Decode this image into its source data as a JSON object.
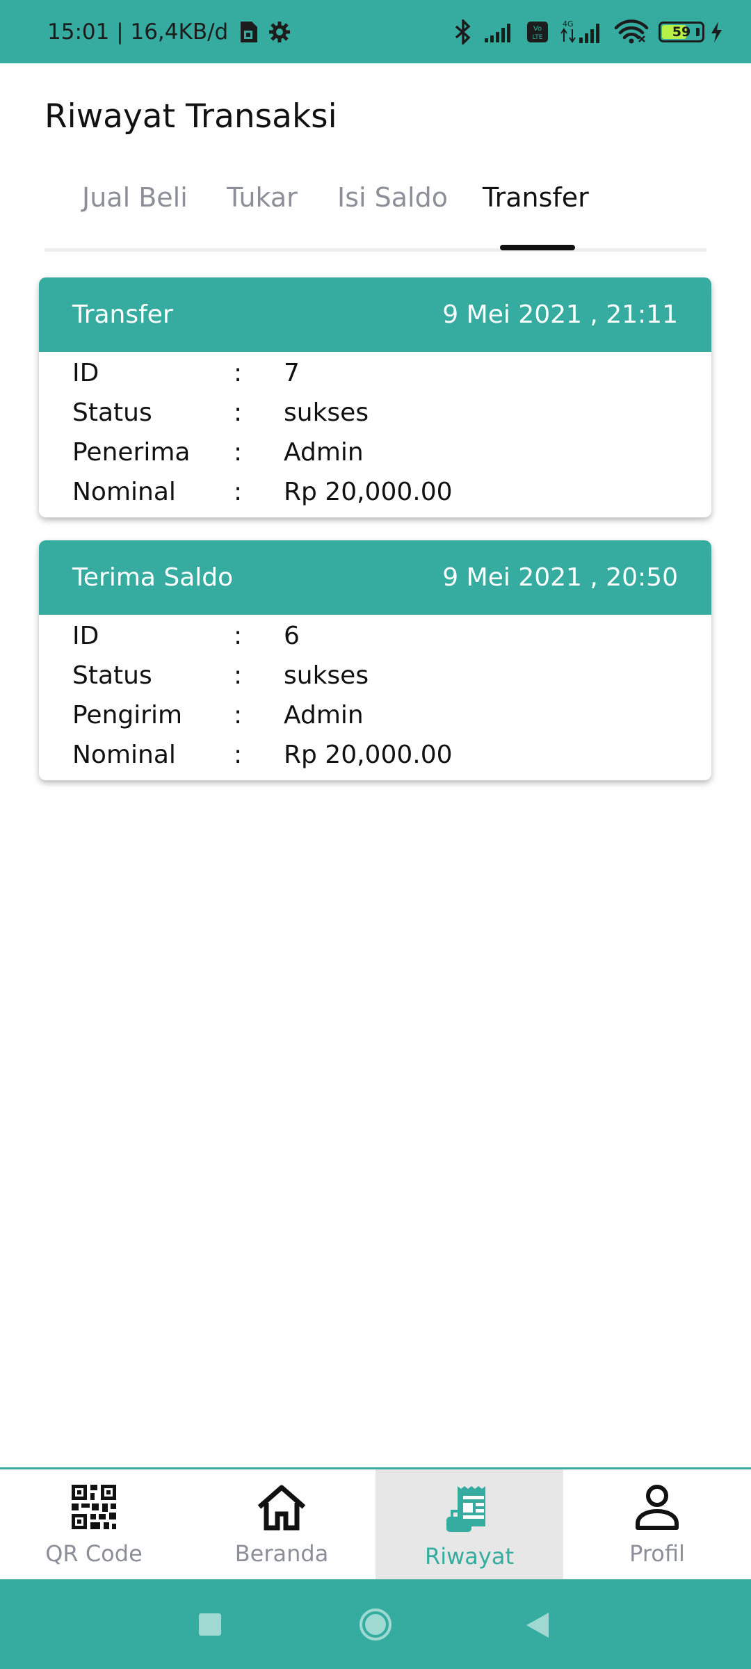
{
  "status_bar": {
    "time_info": "15:01 | 16,4KB/d",
    "battery_level": "59",
    "icons": [
      "sim-card-icon",
      "gear-icon",
      "bluetooth-icon",
      "signal-icon",
      "volte-icon",
      "4g-signal-icon",
      "wifi-icon",
      "battery-icon",
      "charging-bolt-icon"
    ]
  },
  "header": {
    "title": "Riwayat Transaksi"
  },
  "tabs": [
    {
      "label": "Jual Beli",
      "active": false
    },
    {
      "label": "Tukar",
      "active": false
    },
    {
      "label": "Isi Saldo",
      "active": false
    },
    {
      "label": "Transfer",
      "active": true
    }
  ],
  "transactions": [
    {
      "type": "Transfer",
      "datetime": "9 Mei 2021 , 21:11",
      "fields": [
        {
          "label": "ID",
          "value": "7"
        },
        {
          "label": "Status",
          "value": "sukses"
        },
        {
          "label": "Penerima",
          "value": "Admin"
        },
        {
          "label": "Nominal",
          "value": "Rp 20,000.00"
        }
      ]
    },
    {
      "type": "Terima Saldo",
      "datetime": "9 Mei 2021 , 20:50",
      "fields": [
        {
          "label": "ID",
          "value": "6"
        },
        {
          "label": "Status",
          "value": "sukses"
        },
        {
          "label": "Pengirim",
          "value": "Admin"
        },
        {
          "label": "Nominal",
          "value": "Rp 20,000.00"
        }
      ]
    }
  ],
  "separator": ":",
  "bottom_nav": [
    {
      "label": "QR Code",
      "icon": "qr-code-icon",
      "active": false
    },
    {
      "label": "Beranda",
      "icon": "home-icon",
      "active": false
    },
    {
      "label": "Riwayat",
      "icon": "receipt-icon",
      "active": true
    },
    {
      "label": "Profil",
      "icon": "person-icon",
      "active": false
    }
  ],
  "colors": {
    "accent": "#36aca0",
    "active_nav_bg": "#e7e7e7",
    "inactive_text": "#8c8f98"
  }
}
